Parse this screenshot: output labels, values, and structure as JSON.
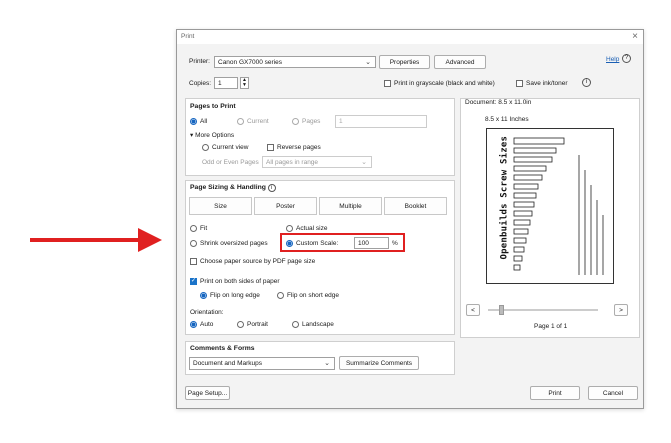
{
  "window": {
    "title": "Print",
    "close_glyph": "×"
  },
  "printer": {
    "label": "Printer:",
    "value": "Canon GX7000 series",
    "properties": "Properties",
    "advanced": "Advanced",
    "help": "Help"
  },
  "copies": {
    "label": "Copies:",
    "value": "1"
  },
  "options": {
    "grayscale": "Print in grayscale (black and white)",
    "save_ink": "Save ink/toner"
  },
  "pages_to_print": {
    "heading": "Pages to Print",
    "all": "All",
    "current": "Current",
    "pages": "Pages",
    "pages_value": "1",
    "more_options": "More Options",
    "current_view": "Current view",
    "reverse_pages": "Reverse pages",
    "odd_even_label": "Odd or Even Pages",
    "odd_even_value": "All pages in range"
  },
  "sizing": {
    "heading": "Page Sizing & Handling",
    "tabs": [
      "Size",
      "Poster",
      "Multiple",
      "Booklet"
    ],
    "fit": "Fit",
    "actual_size": "Actual size",
    "shrink": "Shrink oversized pages",
    "custom_scale": "Custom Scale:",
    "scale_value": "100",
    "percent": "%",
    "paper_source": "Choose paper source by PDF page size"
  },
  "duplex": {
    "print_both_sides": "Print on both sides of paper",
    "flip_long": "Flip on long edge",
    "flip_short": "Flip on short edge"
  },
  "orientation": {
    "label": "Orientation:",
    "auto": "Auto",
    "portrait": "Portrait",
    "landscape": "Landscape"
  },
  "comments": {
    "heading": "Comments & Forms",
    "value": "Document and Markups",
    "summarize": "Summarize Comments"
  },
  "preview": {
    "document_size": "Document: 8.5 x 11.0in",
    "paper_size": "8.5 x 11 Inches",
    "page_label": "Page 1 of 1",
    "prev": "<",
    "next": ">",
    "vertical_title": "Openbuilds Screw Sizes"
  },
  "footer": {
    "page_setup": "Page Setup...",
    "print": "Print",
    "cancel": "Cancel"
  },
  "colors": {
    "accent": "#1565c0",
    "highlight_box": "#e02020",
    "arrow": "#e02020"
  }
}
